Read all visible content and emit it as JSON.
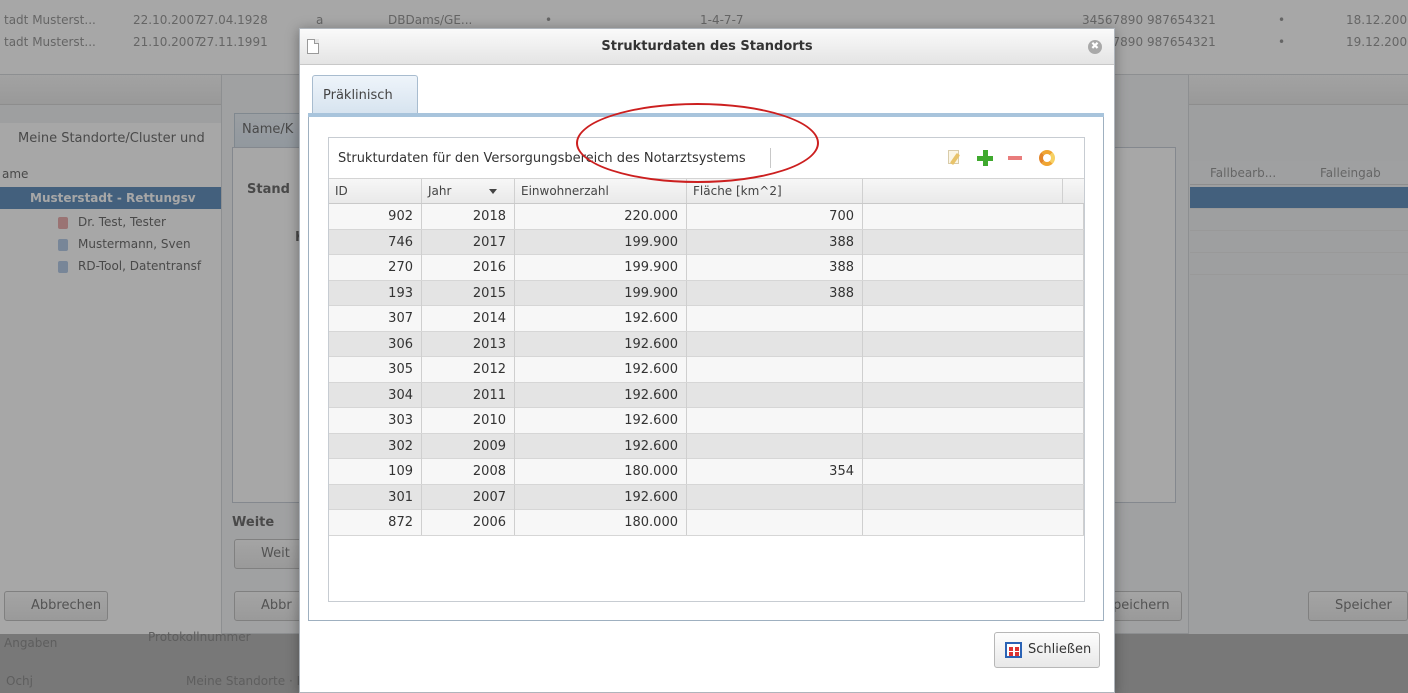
{
  "background": {
    "top_rows": [
      {
        "c1": "tadt Musterst...",
        "c2": "22.10.2007",
        "c3": "27.04.1928",
        "c4": "a",
        "c5": "DBDams/GE...",
        "c6": "•",
        "c7": "1-4-7-7",
        "c8": "34567890",
        "c9": "987654321",
        "c10": "•",
        "c11": "18.12.200"
      },
      {
        "c1": "tadt Musterst...",
        "c2": "21.10.2007",
        "c3": "27.11.1991",
        "c4": "",
        "c5": "",
        "c6": "",
        "c7": "",
        "c8": "34567890",
        "c9": "987654321",
        "c10": "•",
        "c11": "19.12.200"
      }
    ],
    "left_panel": {
      "header": "Meine Standorte/Cluster und",
      "col_label": "ame",
      "selected": "Musterstadt - Rettungsv",
      "items": [
        "Dr. Test, Tester",
        "Mustermann, Sven",
        "RD-Tool, Datentransf"
      ]
    },
    "inner_window": {
      "tab_label": "Name/K",
      "field_label": "Stand",
      "field_label2": "K",
      "section_label": "Weite",
      "weiter_button": "Weit",
      "cancel_button": "Abbr",
      "save_button": "peichern"
    },
    "right_grid": {
      "col1": "Fallbearb...",
      "col2": "Falleingab"
    },
    "outer_cancel": "Abbrechen",
    "outer_save": "Speicher",
    "footer_left": "Angaben",
    "footer_mid": "Protokollnummer",
    "footer_bottom_left": "Ochj",
    "footer_breadcrumb": "Meine Standorte · Musterstadt - Rettungsdienst Stadt Musterstadt"
  },
  "dialog": {
    "title": "Strukturdaten des Standorts",
    "tab": "Präklinisch",
    "grid_caption": "Strukturdaten für den Versorgungsbereich des Notarztsystems",
    "toolbar": {
      "edit_icon": "edit-icon",
      "add_icon": "add-icon",
      "remove_icon": "remove-icon",
      "refresh_icon": "refresh-icon"
    },
    "columns": [
      "ID",
      "Jahr",
      "Einwohnerzahl",
      "Fläche [km^2]"
    ],
    "sort_column": "Jahr",
    "sort_direction": "descending",
    "rows": [
      {
        "id": "902",
        "jahr": "2018",
        "einwohner": "220.000",
        "flaeche": "700"
      },
      {
        "id": "746",
        "jahr": "2017",
        "einwohner": "199.900",
        "flaeche": "388"
      },
      {
        "id": "270",
        "jahr": "2016",
        "einwohner": "199.900",
        "flaeche": "388"
      },
      {
        "id": "193",
        "jahr": "2015",
        "einwohner": "199.900",
        "flaeche": "388"
      },
      {
        "id": "307",
        "jahr": "2014",
        "einwohner": "192.600",
        "flaeche": ""
      },
      {
        "id": "306",
        "jahr": "2013",
        "einwohner": "192.600",
        "flaeche": ""
      },
      {
        "id": "305",
        "jahr": "2012",
        "einwohner": "192.600",
        "flaeche": ""
      },
      {
        "id": "304",
        "jahr": "2011",
        "einwohner": "192.600",
        "flaeche": ""
      },
      {
        "id": "303",
        "jahr": "2010",
        "einwohner": "192.600",
        "flaeche": ""
      },
      {
        "id": "302",
        "jahr": "2009",
        "einwohner": "192.600",
        "flaeche": ""
      },
      {
        "id": "109",
        "jahr": "2008",
        "einwohner": "180.000",
        "flaeche": "354"
      },
      {
        "id": "301",
        "jahr": "2007",
        "einwohner": "192.600",
        "flaeche": ""
      },
      {
        "id": "872",
        "jahr": "2006",
        "einwohner": "180.000",
        "flaeche": ""
      }
    ],
    "close_button": "Schließen",
    "highlight_color": "#cc1f1f"
  }
}
